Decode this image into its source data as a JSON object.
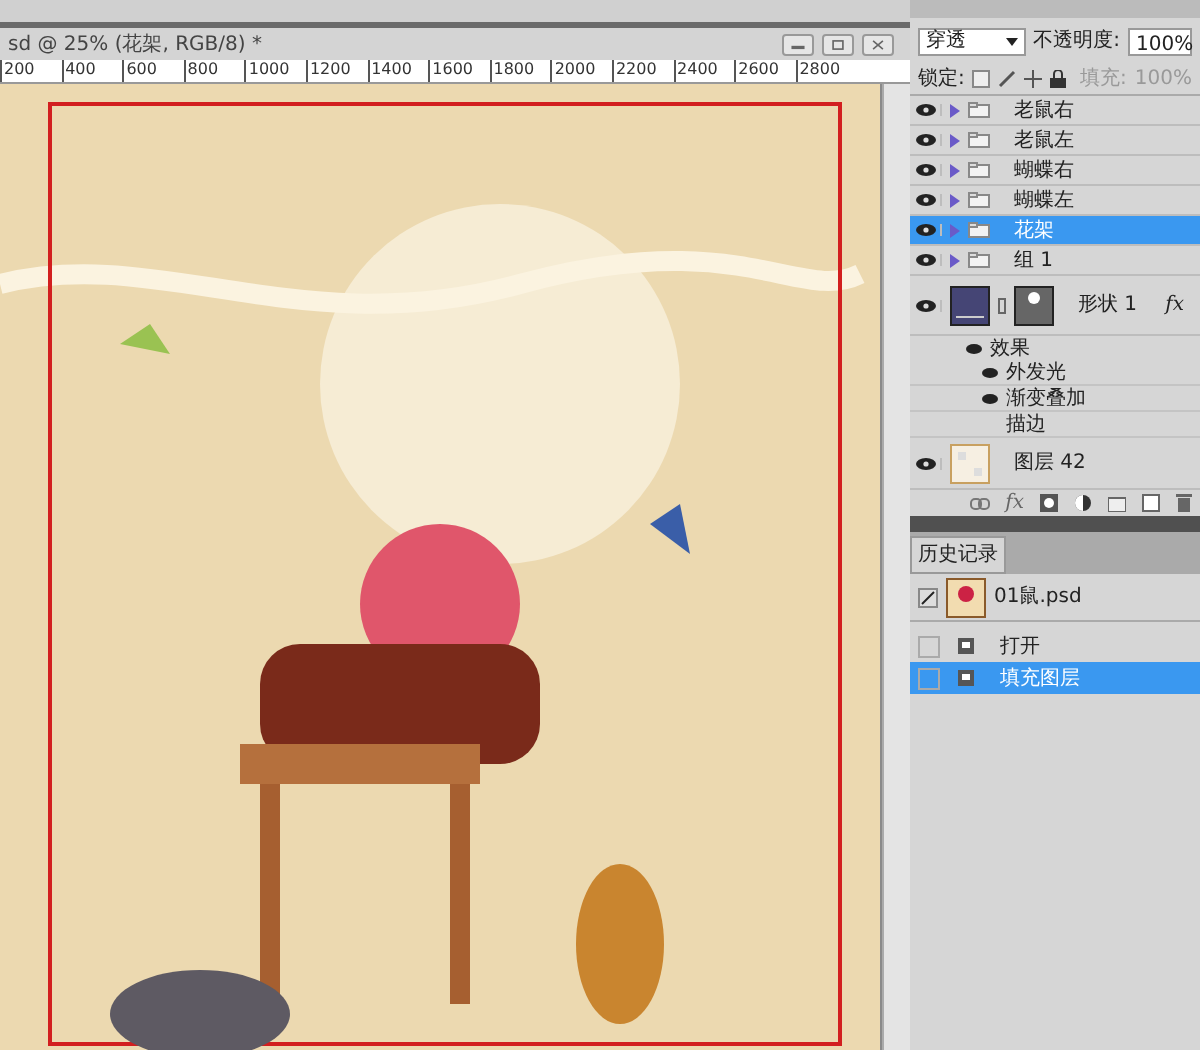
{
  "document": {
    "title": "sd @ 25% (花架, RGB/8) *",
    "ruler_labels": [
      "200",
      "400",
      "600",
      "800",
      "1000",
      "1200",
      "1400",
      "1600",
      "1800",
      "2000",
      "2200",
      "2400",
      "2600",
      "2800"
    ]
  },
  "layers_panel": {
    "blend_mode": "穿透",
    "opacity_label": "不透明度:",
    "opacity": "100%",
    "lock_label": "锁定:",
    "fill_label": "填充:",
    "fill": "100%",
    "layers": [
      {
        "kind": "group",
        "name": "老鼠右",
        "visible": true,
        "selected": false
      },
      {
        "kind": "group",
        "name": "老鼠左",
        "visible": true,
        "selected": false
      },
      {
        "kind": "group",
        "name": "蝴蝶右",
        "visible": true,
        "selected": false
      },
      {
        "kind": "group",
        "name": "蝴蝶左",
        "visible": true,
        "selected": false
      },
      {
        "kind": "group",
        "name": "花架",
        "visible": true,
        "selected": true
      },
      {
        "kind": "group",
        "name": "组 1",
        "visible": true,
        "selected": false
      },
      {
        "kind": "shape",
        "name": "形状 1",
        "visible": true,
        "selected": false,
        "fx": "fx",
        "effects_label": "效果",
        "effects": [
          {
            "name": "外发光",
            "visible": true
          },
          {
            "name": "渐变叠加",
            "visible": true
          },
          {
            "name": "描边",
            "visible": false
          }
        ]
      },
      {
        "kind": "pixel",
        "name": "图层 42",
        "visible": true,
        "selected": false
      }
    ],
    "footer_fx": "fx"
  },
  "history_panel": {
    "tab": "历史记录",
    "snapshot": "01鼠.psd",
    "steps": [
      {
        "label": "打开",
        "selected": false
      },
      {
        "label": "填充图层",
        "selected": true
      }
    ]
  }
}
